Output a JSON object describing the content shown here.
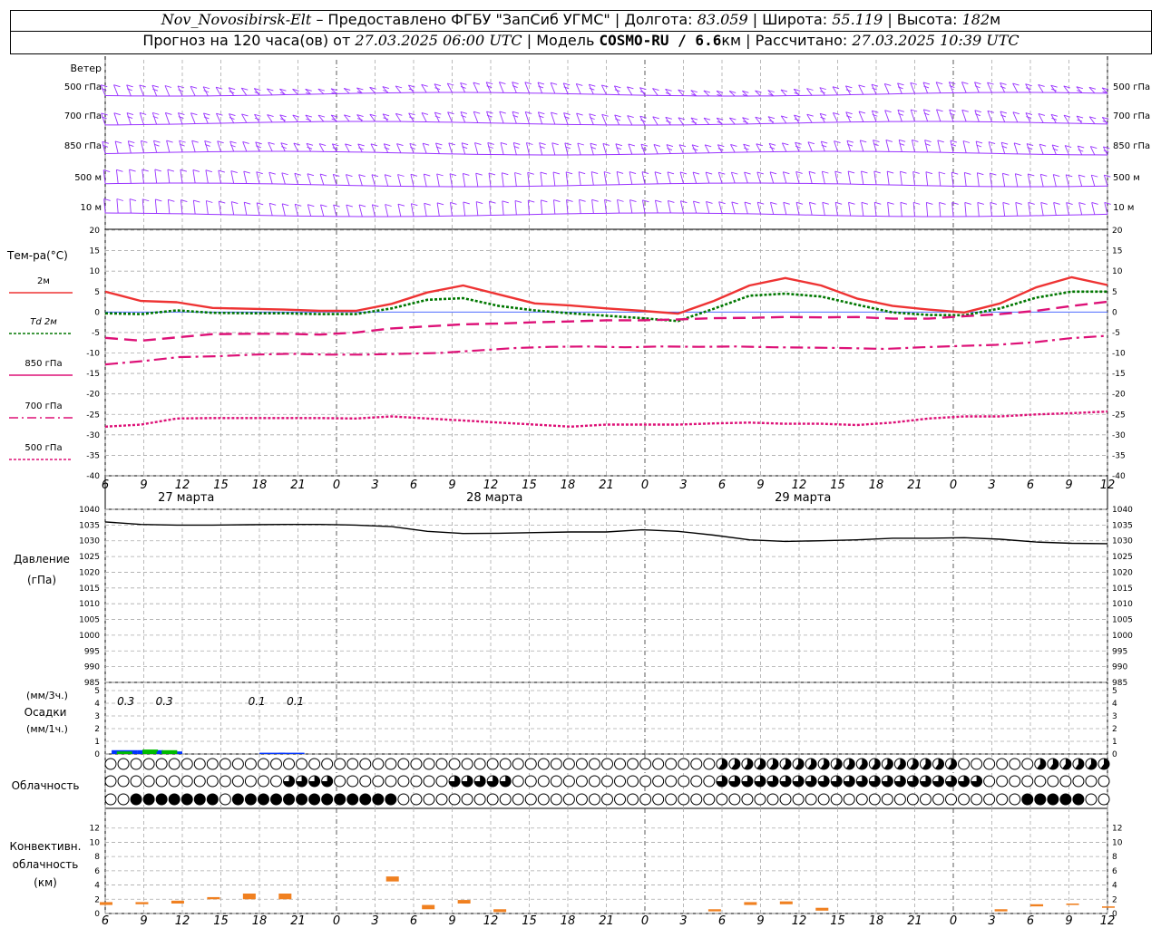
{
  "header": {
    "station": "Nov_Novosibirsk-Elt",
    "provided_by": " – Предоставлено ФГБУ \"ЗапСиб УГМС\" | ",
    "lon_label": "Долгота: ",
    "lon_value": "83.059",
    "lat_label": " | Широта: ",
    "lat_value": "55.119",
    "alt_label": " | Высота: ",
    "alt_value": "182",
    "alt_unit": "м",
    "forecast_label": "Прогноз на 120 часа(ов) от ",
    "forecast_time": "27.03.2025 06:00 UTC",
    "model_label": " | Модель ",
    "model_name": "COSMO-RU / 6.6",
    "model_unit": "км",
    "calc_label": " | Рассчитано: ",
    "calc_time": "27.03.2025 10:39 UTC"
  },
  "panels": {
    "wind": {
      "title": "Ветер",
      "levels": [
        "500 гПа",
        "700 гПа",
        "850 гПа",
        "500 м",
        "10  м"
      ],
      "levels_right": [
        "500 гПа",
        "700 гПа",
        "850 гПа",
        "500 м",
        "10  м"
      ]
    },
    "temperature": {
      "title": "Тем-ра(°С)",
      "legend": [
        "2м",
        "Td  2м",
        "850 гПа",
        "700 гПа",
        "500 гПа"
      ],
      "yticks": [
        "20",
        "15",
        "10",
        "5",
        "0",
        "-5",
        "-10",
        "-15",
        "-20",
        "-25",
        "-30",
        "-35",
        "-40"
      ]
    },
    "pressure": {
      "title": "Давление",
      "unit": "(гПа)",
      "yticks": [
        "1040",
        "1035",
        "1030",
        "1025",
        "1020",
        "1015",
        "1010",
        "1005",
        "1000",
        "995",
        "990",
        "985"
      ]
    },
    "precip": {
      "unit1": "(мм/3ч.)",
      "title": "Осадки",
      "unit2": "(мм/1ч.)",
      "yticks": [
        "5",
        "4",
        "3",
        "2",
        "1",
        "0"
      ],
      "labels": [
        "0.3",
        "0.3",
        "0.1",
        "0.1"
      ]
    },
    "cloud": {
      "title": "Облачность"
    },
    "convective": {
      "title1": "Конвективн.",
      "title2": "облачность",
      "unit": "(км)",
      "yticks": [
        "12",
        "10",
        "8",
        "6",
        "4",
        "2",
        "0"
      ]
    }
  },
  "time_axis": {
    "hour_labels": [
      "6",
      "9",
      "12",
      "15",
      "18",
      "21",
      "0",
      "3",
      "6",
      "9",
      "12",
      "15",
      "18",
      "21",
      "0",
      "3",
      "6",
      "9",
      "12",
      "15",
      "18",
      "21",
      "0",
      "3",
      "6",
      "9",
      "12"
    ],
    "date_labels": [
      "27 марта",
      "28 марта",
      "29 марта"
    ]
  },
  "colors": {
    "wind": "#9933ff",
    "t2m": "#ee3333",
    "td2m": "#007700",
    "t_levels": "#dd1177",
    "pressure": "#000000",
    "precip_3h": "#0033ff",
    "precip_1h": "#00bb00",
    "convective": "#f08020"
  },
  "chart_data": [
    {
      "type": "line",
      "x": [
        6,
        9,
        12,
        15,
        18,
        21,
        24,
        27,
        30,
        33,
        36,
        39,
        42,
        45,
        48,
        51,
        54,
        57,
        60,
        63,
        66,
        69,
        72,
        75,
        78,
        81,
        84
      ],
      "series": [
        {
          "name": "2м",
          "values": [
            5,
            2.7,
            2.4,
            1,
            0.8,
            0.6,
            0.3,
            0.3,
            2,
            4.8,
            6.5,
            4.3,
            2.1,
            1.6,
            0.9,
            0.3,
            -0.4,
            2.7,
            6.5,
            8.3,
            6.5,
            3.3,
            1.5,
            0.6,
            -0.1,
            2.1,
            6,
            8.5,
            6.6
          ]
        },
        {
          "name": "Td  2м",
          "values": [
            -0.3,
            -0.5,
            0.4,
            -0.2,
            -0.3,
            -0.3,
            -0.5,
            -0.5,
            0.9,
            3,
            3.4,
            1.5,
            0.4,
            -0.3,
            -0.9,
            -1.5,
            -2.2,
            0.8,
            4,
            4.5,
            3.8,
            1.8,
            -0.1,
            -0.7,
            -0.8,
            0.9,
            3.5,
            5,
            5
          ]
        },
        {
          "name": "850 гПа",
          "values": [
            -6.3,
            -7,
            -6.2,
            -5.4,
            -5.3,
            -5.3,
            -5.5,
            -5,
            -4,
            -3.5,
            -3,
            -2.8,
            -2.5,
            -2.3,
            -2,
            -2,
            -1.8,
            -1.5,
            -1.4,
            -1.2,
            -1.3,
            -1.2,
            -1.6,
            -1.6,
            -1,
            -0.5,
            0.3,
            1.5,
            2.5
          ]
        },
        {
          "name": "700 гПа",
          "values": [
            -12.8,
            -12,
            -11,
            -10.8,
            -10.4,
            -10.2,
            -10.4,
            -10.4,
            -10.2,
            -10,
            -9.4,
            -8.8,
            -8.5,
            -8.4,
            -8.6,
            -8.4,
            -8.5,
            -8.4,
            -8.6,
            -8.7,
            -8.8,
            -9,
            -8.6,
            -8.3,
            -8,
            -7.4,
            -6.4,
            -5.8
          ]
        },
        {
          "name": "500 гПа",
          "values": [
            -28,
            -27.5,
            -26,
            -25.9,
            -25.9,
            -25.9,
            -25.9,
            -26,
            -25.5,
            -26,
            -26.5,
            -27,
            -27.5,
            -28,
            -27.5,
            -27.5,
            -27.5,
            -27.2,
            -27,
            -27.3,
            -27.3,
            -27.6,
            -27,
            -26,
            -25.5,
            -25.5,
            -25,
            -24.7,
            -24.3
          ]
        }
      ],
      "ylim": [
        -40,
        20
      ]
    },
    {
      "type": "line",
      "x": [
        6,
        9,
        12,
        15,
        18,
        21,
        24,
        27,
        30,
        33,
        36,
        39,
        42,
        45,
        48,
        51,
        54,
        57,
        60,
        63,
        66,
        69,
        72,
        75,
        78,
        81,
        84
      ],
      "series": [
        {
          "name": "Давление",
          "values": [
            1036,
            1035.2,
            1035,
            1035,
            1035.1,
            1035.2,
            1035.2,
            1035,
            1034.5,
            1033,
            1032.3,
            1032.4,
            1032.6,
            1032.8,
            1032.8,
            1033.5,
            1033,
            1031.8,
            1030.3,
            1029.8,
            1030,
            1030.3,
            1030.8,
            1030.8,
            1031,
            1030.5,
            1029.6,
            1029.2,
            1029.1
          ]
        }
      ],
      "ylim": [
        985,
        1040
      ]
    },
    {
      "type": "bar",
      "x": [
        7.5,
        9.5,
        11,
        19,
        20.5
      ],
      "series": [
        {
          "name": "мм/3ч.",
          "values": [
            0.3,
            0.3,
            0.2,
            0.1,
            0.1
          ]
        },
        {
          "name": "мм/1ч.",
          "values": [
            0.2,
            0.35,
            0.3,
            0,
            0
          ]
        }
      ],
      "ylim": [
        0,
        5
      ]
    },
    {
      "type": "bar",
      "x": [
        6,
        9,
        12,
        15,
        18,
        21,
        24,
        27,
        30,
        33,
        36,
        39,
        42,
        45,
        48,
        51,
        54,
        57,
        60,
        63,
        66,
        69,
        72,
        75,
        78,
        81,
        84
      ],
      "series": [
        {
          "name": "base",
          "values": [
            1.2,
            1.3,
            1.4,
            2,
            2,
            2,
            0,
            0,
            4.5,
            0.6,
            1.4,
            0.2,
            0,
            0,
            0,
            0,
            0,
            0.3,
            1.2,
            1.3,
            0.4,
            0,
            0,
            0,
            0,
            0.3,
            1,
            1.2,
            0.8
          ]
        },
        {
          "name": "top",
          "values": [
            1.6,
            1.6,
            1.8,
            2.3,
            2.8,
            2.8,
            0,
            0,
            5.2,
            1.2,
            1.9,
            0.6,
            0,
            0,
            0,
            0,
            0,
            0.6,
            1.6,
            1.7,
            0.8,
            0,
            0,
            0,
            0,
            0.6,
            1.3,
            1.4,
            1
          ]
        }
      ],
      "ylim": [
        0,
        14
      ]
    }
  ]
}
